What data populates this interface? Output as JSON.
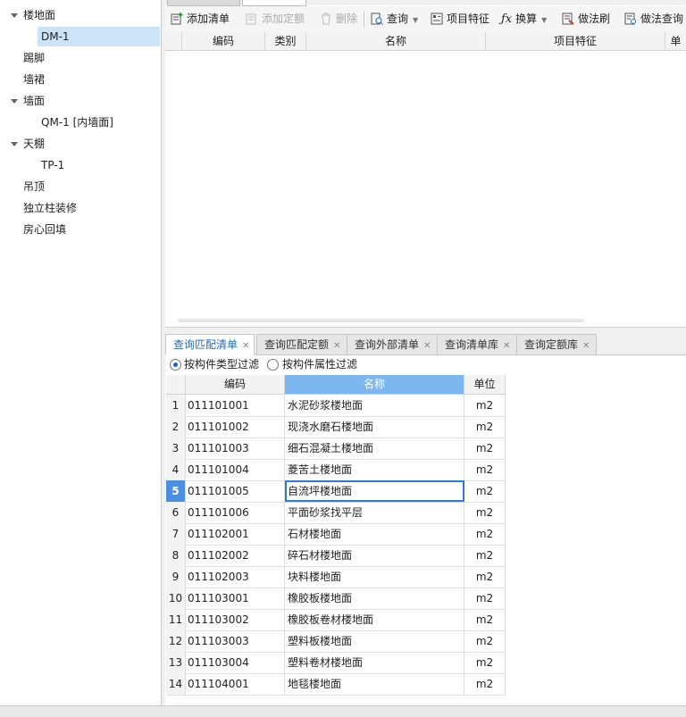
{
  "tree": [
    {
      "label": "楼地面",
      "expanded": true,
      "level": 0
    },
    {
      "label": "DM-1",
      "level": 1,
      "selected": true
    },
    {
      "label": "踢脚",
      "level": 0
    },
    {
      "label": "墙裙",
      "level": 0
    },
    {
      "label": "墙面",
      "expanded": true,
      "level": 0
    },
    {
      "label": "QM-1 [内墙面]",
      "level": 1
    },
    {
      "label": "天棚",
      "expanded": true,
      "level": 0
    },
    {
      "label": "TP-1",
      "level": 1
    },
    {
      "label": "吊顶",
      "level": 0
    },
    {
      "label": "独立柱装修",
      "level": 0
    },
    {
      "label": "房心回填",
      "level": 0
    }
  ],
  "toolbar": {
    "add_list": "添加清单",
    "add_quota": "添加定额",
    "delete": "删除",
    "query": "查询",
    "features": "项目特征",
    "convert": "换算",
    "brush": "做法刷",
    "query_method": "做法查询"
  },
  "upper_grid_headers": [
    "编码",
    "类别",
    "名称",
    "项目特征",
    "单"
  ],
  "bottom_tabs": [
    "查询匹配清单",
    "查询匹配定额",
    "查询外部清单",
    "查询清单库",
    "查询定额库"
  ],
  "filters": {
    "by_type": "按构件类型过滤",
    "by_attr": "按构件属性过滤"
  },
  "list_headers": {
    "code": "编码",
    "name": "名称",
    "unit": "单位"
  },
  "rows": [
    {
      "n": "1",
      "code": "011101001",
      "name": "水泥砂浆楼地面",
      "unit": "m2"
    },
    {
      "n": "2",
      "code": "011101002",
      "name": "现浇水磨石楼地面",
      "unit": "m2"
    },
    {
      "n": "3",
      "code": "011101003",
      "name": "细石混凝土楼地面",
      "unit": "m2"
    },
    {
      "n": "4",
      "code": "011101004",
      "name": "菱苦土楼地面",
      "unit": "m2"
    },
    {
      "n": "5",
      "code": "011101005",
      "name": "自流坪楼地面",
      "unit": "m2"
    },
    {
      "n": "6",
      "code": "011101006",
      "name": "平面砂浆找平层",
      "unit": "m2"
    },
    {
      "n": "7",
      "code": "011102001",
      "name": "石材楼地面",
      "unit": "m2"
    },
    {
      "n": "8",
      "code": "011102002",
      "name": "碎石材楼地面",
      "unit": "m2"
    },
    {
      "n": "9",
      "code": "011102003",
      "name": "块料楼地面",
      "unit": "m2"
    },
    {
      "n": "10",
      "code": "011103001",
      "name": "橡胶板楼地面",
      "unit": "m2"
    },
    {
      "n": "11",
      "code": "011103002",
      "name": "橡胶板卷材楼地面",
      "unit": "m2"
    },
    {
      "n": "12",
      "code": "011103003",
      "name": "塑料板楼地面",
      "unit": "m2"
    },
    {
      "n": "13",
      "code": "011103004",
      "name": "塑料卷材楼地面",
      "unit": "m2"
    },
    {
      "n": "14",
      "code": "011104001",
      "name": "地毯楼地面",
      "unit": "m2"
    }
  ]
}
